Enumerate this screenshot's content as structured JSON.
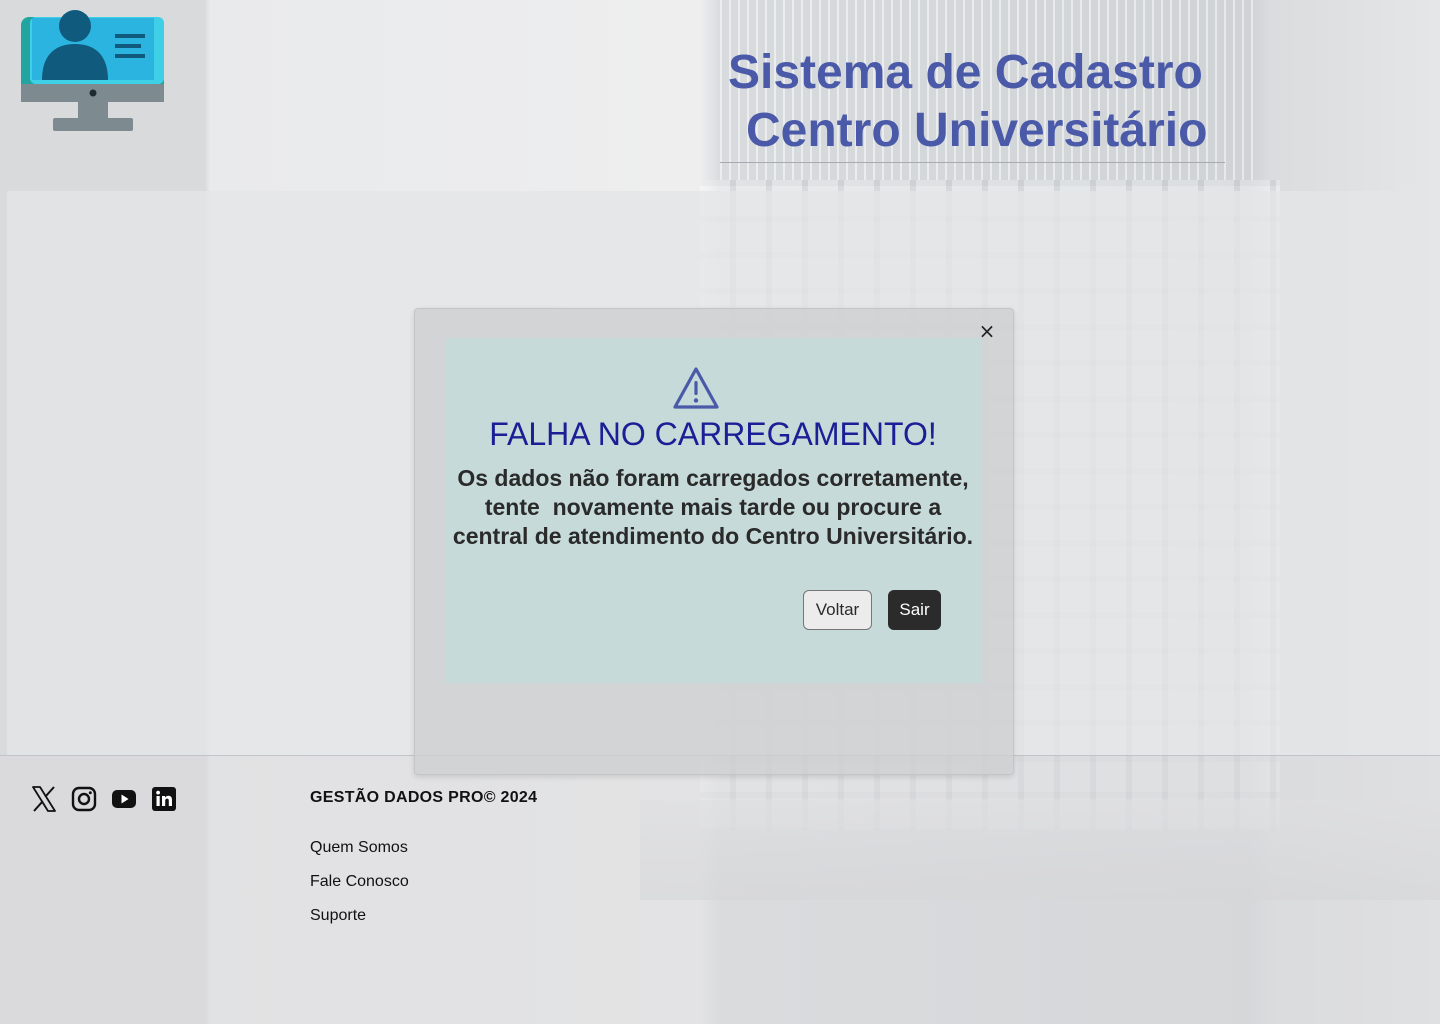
{
  "header": {
    "logo_icon": "computer-user-profile-icon",
    "title_line1": "Sistema de Cadastro",
    "title_line2": "Centro Universitário"
  },
  "modal": {
    "close_label": "×",
    "icon": "warning-triangle-icon",
    "title": "FALHA NO CARREGAMENTO!",
    "message_lines": [
      "Os dados não foram carregados corretamente,",
      "tente  novamente mais tarde ou procure a",
      "central de atendimento do Centro Universitário."
    ],
    "buttons": {
      "back": "Voltar",
      "exit": "Sair"
    }
  },
  "footer": {
    "social": [
      {
        "name": "x-twitter-icon"
      },
      {
        "name": "instagram-icon"
      },
      {
        "name": "youtube-icon"
      },
      {
        "name": "linkedin-icon"
      }
    ],
    "brand": "GESTÃO DADOS PRO© 2024",
    "links": [
      "Quem Somos",
      "Fale Conosco",
      "Suporte"
    ]
  },
  "colors": {
    "title": "#4a5aa9",
    "modal_title": "#1b1f96",
    "modal_card": "#c5dad9",
    "exit_button": "#2b2b2b"
  }
}
